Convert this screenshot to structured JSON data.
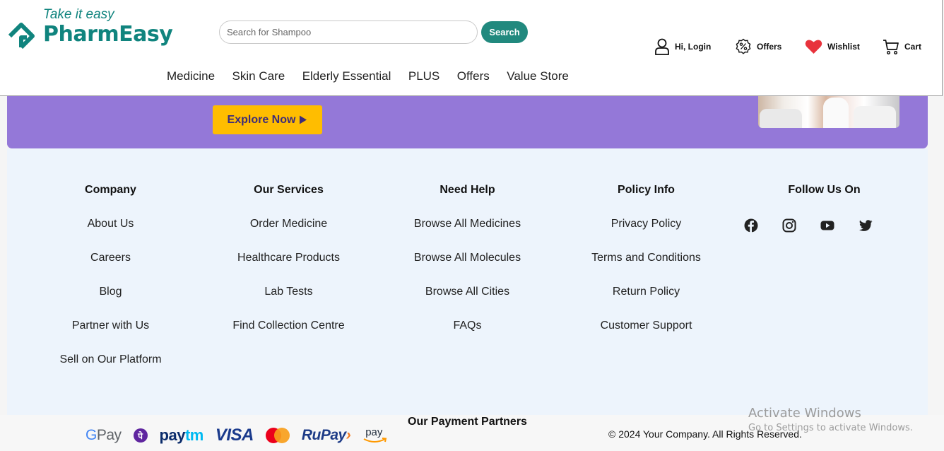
{
  "brand": {
    "tagline": "Take it easy",
    "name": "PharmEasy",
    "color": "#10847e"
  },
  "search": {
    "placeholder": "Search for Shampoo",
    "button_label": "Search"
  },
  "nav": [
    "Medicine",
    "Skin Care",
    "Elderly Essential",
    "PLUS",
    "Offers",
    "Value Store"
  ],
  "header_actions": {
    "login": "Hi, Login",
    "offers": "Offers",
    "wishlist": "Wishlist",
    "cart": "Cart"
  },
  "banner": {
    "cta_label": "Explore Now",
    "color": "#9478d8",
    "cta_color": "#ffbd00"
  },
  "footer": {
    "columns": [
      {
        "title": "Company",
        "links": [
          "About Us",
          "Careers",
          "Blog",
          "Partner with Us",
          "Sell on Our Platform"
        ]
      },
      {
        "title": "Our Services",
        "links": [
          "Order Medicine",
          "Healthcare Products",
          "Lab Tests",
          "Find Collection Centre"
        ]
      },
      {
        "title": "Need Help",
        "links": [
          "Browse All Medicines",
          "Browse All Molecules",
          "Browse All Cities",
          "FAQs"
        ]
      },
      {
        "title": "Policy Info",
        "links": [
          "Privacy Policy",
          "Terms and Conditions",
          "Return Policy",
          "Customer Support"
        ]
      }
    ],
    "follow_title": "Follow Us On",
    "social": [
      "facebook-icon",
      "instagram-icon",
      "youtube-icon",
      "twitter-icon"
    ],
    "payment_title": "Our Payment Partners",
    "payment_partners": [
      "G Pay",
      "PhonePe",
      "paytm",
      "VISA",
      "Mastercard",
      "RuPay",
      "Amazon Pay"
    ],
    "payment_logos": {
      "gpay_g": "G",
      "gpay_rest": "Pay",
      "phonepe_glyph": "पे",
      "paytm_a": "pay",
      "paytm_b": "tm",
      "visa": "VISA",
      "rupay_a": "RuPay",
      "rupay_b": "›",
      "amazon_pay": "pay"
    },
    "copyright": "© 2024 Your Company. All Rights Reserved."
  },
  "os_watermark": {
    "line1": "Activate Windows",
    "line2": "Go to Settings to activate Windows."
  }
}
